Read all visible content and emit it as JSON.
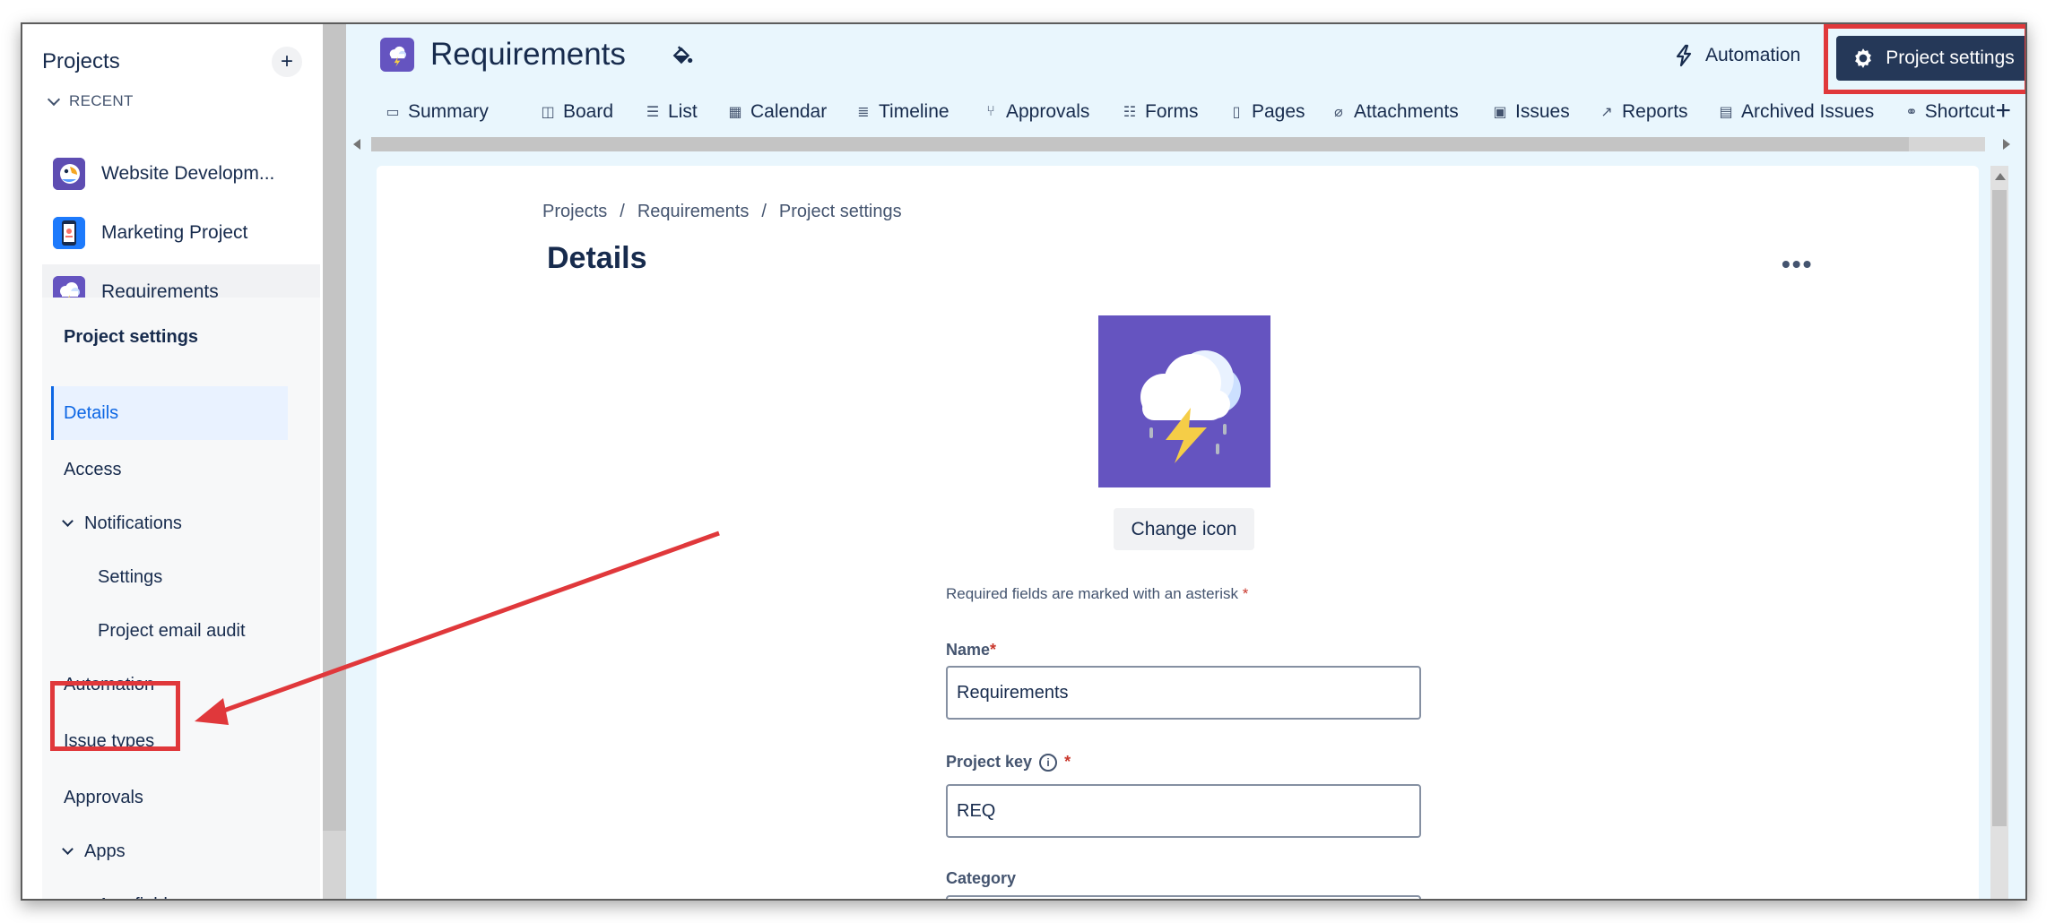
{
  "sidebar": {
    "title": "Projects",
    "add_label": "+",
    "recent_label": "RECENT",
    "projects": [
      {
        "label": "Website Developm...",
        "icon": "parrot-icon"
      },
      {
        "label": "Marketing Project",
        "icon": "phone-icon"
      },
      {
        "label": "Requirements",
        "icon": "storm-cloud-icon"
      }
    ],
    "settings_nav": {
      "heading": "Project settings",
      "items": [
        {
          "label": "Details"
        },
        {
          "label": "Access"
        },
        {
          "label": "Notifications"
        },
        {
          "label": "Settings"
        },
        {
          "label": "Project email audit"
        },
        {
          "label": "Automation"
        },
        {
          "label": "Issue types"
        },
        {
          "label": "Approvals"
        },
        {
          "label": "Apps"
        },
        {
          "label": "App fields"
        }
      ]
    }
  },
  "header": {
    "project_name": "Requirements",
    "automation_label": "Automation",
    "project_settings_label": "Project settings",
    "tabs": [
      {
        "label": "Summary",
        "icon": "summary-icon"
      },
      {
        "label": "Board",
        "icon": "board-icon"
      },
      {
        "label": "List",
        "icon": "list-icon"
      },
      {
        "label": "Calendar",
        "icon": "calendar-icon"
      },
      {
        "label": "Timeline",
        "icon": "timeline-icon"
      },
      {
        "label": "Approvals",
        "icon": "approvals-icon"
      },
      {
        "label": "Forms",
        "icon": "forms-icon"
      },
      {
        "label": "Pages",
        "icon": "pages-icon"
      },
      {
        "label": "Attachments",
        "icon": "attachment-icon"
      },
      {
        "label": "Issues",
        "icon": "issues-icon"
      },
      {
        "label": "Reports",
        "icon": "reports-icon"
      },
      {
        "label": "Archived Issues",
        "icon": "archive-icon"
      },
      {
        "label": "Shortcut",
        "icon": "link-icon"
      }
    ]
  },
  "main": {
    "breadcrumb": [
      "Projects",
      "Requirements",
      "Project settings"
    ],
    "breadcrumb_sep": "/",
    "title": "Details",
    "more_label": "•••",
    "change_icon_label": "Change icon",
    "required_note": "Required fields are marked with an asterisk",
    "asterisk": "*",
    "fields": {
      "name_label": "Name",
      "name_value": "Requirements",
      "key_label": "Project key",
      "key_value": "REQ",
      "category_label": "Category"
    }
  },
  "colors": {
    "accent": "#0c66e4",
    "annotation": "#e0383b",
    "header_bg": "#e9f6fd",
    "project_icon_bg": "#6554c0",
    "button_dark": "#253858"
  }
}
